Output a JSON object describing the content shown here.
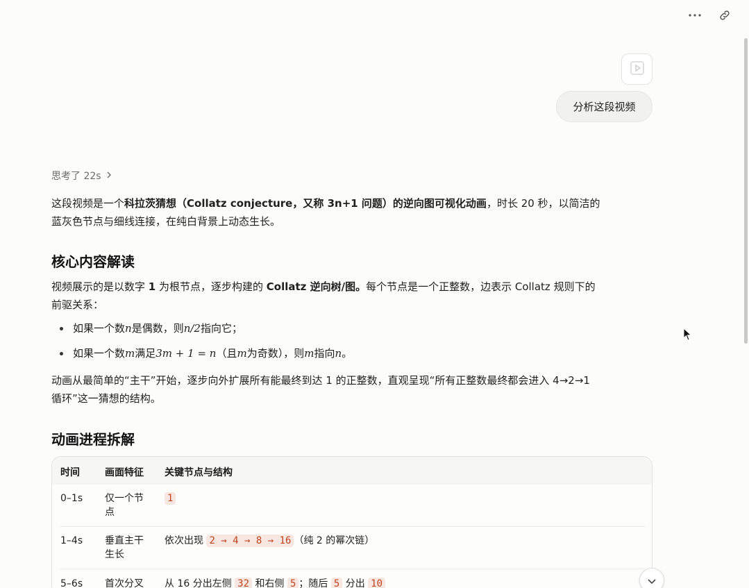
{
  "icons": {
    "more": "more-horizontal-icon",
    "link": "link-icon",
    "video": "video-play-icon",
    "chevron_right": "chevron-right-icon",
    "scroll_down": "chevron-down-icon"
  },
  "user_message": {
    "text": "分析这段视频"
  },
  "thought": {
    "label": "思考了 22s"
  },
  "intro": {
    "p1": "这段视频是一个",
    "bold": "科拉茨猜想（Collatz conjecture，又称 3n+1 问题）的逆向图可视化动画",
    "p2": "，时长 20 秒，以简洁的",
    "line2": "蓝灰色节点与细线连接，在纯白背景上动态生长。"
  },
  "section1": {
    "title": "核心内容解读",
    "p_a": "视频展示的是以数字 ",
    "p_one": "1",
    "p_b": " 为根节点，逐步构建的 ",
    "p_bold": "Collatz 逆向树/图。",
    "p_c": "每个节点是一个正整数，边表示 Collatz 规则下的",
    "p_line2": "前驱关系：",
    "bullet1": {
      "a": "如果一个数 ",
      "m1": "n",
      "b": " 是偶数，则 ",
      "m2": "n/2",
      "c": " 指向它；"
    },
    "bullet2": {
      "a": "如果一个数 ",
      "m1": "m",
      "b": " 满足 ",
      "m2": "3m + 1 = n",
      "c": "（且 ",
      "m3": "m",
      "d": " 为奇数），则 ",
      "m4": "m",
      "e": " 指向 ",
      "m5": "n",
      "f": "。"
    },
    "closing1": "动画从最简单的“主干”开始，逐步向外扩展所有能最终到达 1 的正整数，直观呈现“所有正整数最终都会进入 4→2→1",
    "closing2": "循环”这一猜想的结构。"
  },
  "section2": {
    "title": "动画进程拆解",
    "headers": [
      "时间",
      "画面特征",
      "关键节点与结构"
    ],
    "rows": [
      {
        "time": "0–1s",
        "feature_l1": "仅一个节",
        "feature_l2": "点",
        "tag": "1"
      },
      {
        "time": "1–4s",
        "feature_l1": "垂直主干",
        "feature_l2": "生长",
        "lead": "依次出现 ",
        "chain": "2 → 4 → 8 → 16",
        "tail": "（纯 2 的幂次链）"
      },
      {
        "time": "5–6s",
        "feature_l1": "首次分叉",
        "a": "从 16 分出左侧 ",
        "t1": "32",
        "b": " 和右侧 ",
        "t2": "5",
        "c": "；随后 ",
        "t3": "5",
        "d": " 分出 ",
        "t4": "10"
      }
    ]
  }
}
